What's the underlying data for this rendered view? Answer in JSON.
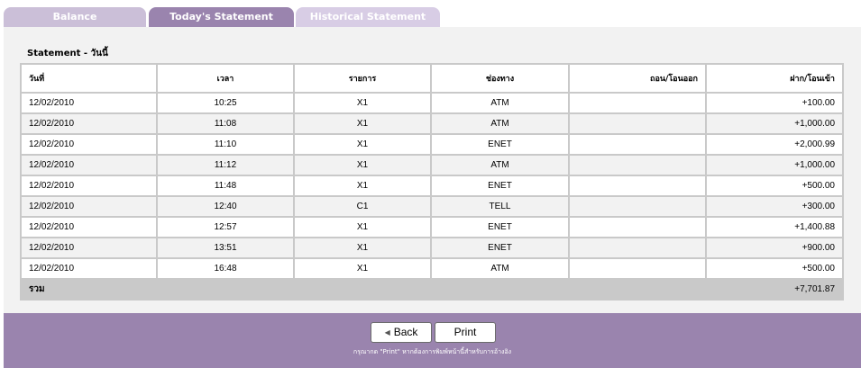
{
  "tabs": {
    "balance": "Balance",
    "today": "Today's Statement",
    "historical": "Historical Statement"
  },
  "statement": {
    "title": "Statement - วันนี้",
    "columns": [
      "วันที่",
      "เวลา",
      "รายการ",
      "ช่องทาง",
      "ถอน/โอนออก",
      "ฝาก/โอนเข้า"
    ],
    "rows": [
      {
        "date": "12/02/2010",
        "time": "10:25",
        "item": "X1",
        "channel": "ATM",
        "withdraw": "",
        "deposit": "+100.00"
      },
      {
        "date": "12/02/2010",
        "time": "11:08",
        "item": "X1",
        "channel": "ATM",
        "withdraw": "",
        "deposit": "+1,000.00"
      },
      {
        "date": "12/02/2010",
        "time": "11:10",
        "item": "X1",
        "channel": "ENET",
        "withdraw": "",
        "deposit": "+2,000.99"
      },
      {
        "date": "12/02/2010",
        "time": "11:12",
        "item": "X1",
        "channel": "ATM",
        "withdraw": "",
        "deposit": "+1,000.00"
      },
      {
        "date": "12/02/2010",
        "time": "11:48",
        "item": "X1",
        "channel": "ENET",
        "withdraw": "",
        "deposit": "+500.00"
      },
      {
        "date": "12/02/2010",
        "time": "12:40",
        "item": "C1",
        "channel": "TELL",
        "withdraw": "",
        "deposit": "+300.00"
      },
      {
        "date": "12/02/2010",
        "time": "12:57",
        "item": "X1",
        "channel": "ENET",
        "withdraw": "",
        "deposit": "+1,400.88"
      },
      {
        "date": "12/02/2010",
        "time": "13:51",
        "item": "X1",
        "channel": "ENET",
        "withdraw": "",
        "deposit": "+900.00"
      },
      {
        "date": "12/02/2010",
        "time": "16:48",
        "item": "X1",
        "channel": "ATM",
        "withdraw": "",
        "deposit": "+500.00"
      }
    ],
    "total_label": "รวม",
    "total_withdraw": "",
    "total_deposit": "+7,701.87"
  },
  "footer": {
    "back_label": "Back",
    "print_label": "Print",
    "note": "กรุณากด \"Print\" หากต้องการพิมพ์หน้านี้สำหรับการอ้างอิง"
  },
  "colors": {
    "active_tab": "#9a84ae",
    "footer_bg": "#9a84ae",
    "inactive_tab": "#cbbfd8"
  },
  "icons": {
    "back": "triangle-left-icon"
  }
}
